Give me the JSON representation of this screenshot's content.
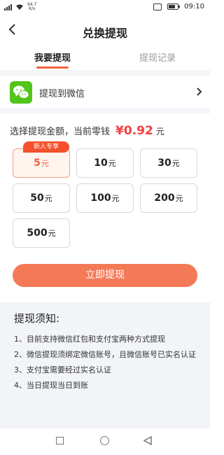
{
  "status_bar": {
    "speed_value": "94.7",
    "speed_unit": "K/s",
    "time": "09:10"
  },
  "header": {
    "title": "兑换提现"
  },
  "tabs": [
    {
      "label": "我要提现"
    },
    {
      "label": "提现记录"
    }
  ],
  "method": {
    "label": "提现到微信",
    "icon": "wechat-icon"
  },
  "amount": {
    "label": "选择提现金额，当前零钱",
    "currency_symbol": "¥",
    "value": "0.92",
    "unit": "元"
  },
  "options": [
    {
      "value": "5",
      "unit": "元",
      "badge": "新人专享",
      "selected": true
    },
    {
      "value": "10",
      "unit": "元"
    },
    {
      "value": "30",
      "unit": "元"
    },
    {
      "value": "50",
      "unit": "元"
    },
    {
      "value": "100",
      "unit": "元"
    },
    {
      "value": "200",
      "unit": "元"
    },
    {
      "value": "500",
      "unit": "元"
    }
  ],
  "withdraw_button": {
    "label": "立即提现"
  },
  "notes": {
    "title": "提现须知:",
    "items": [
      "1、目前支持微信红包和支付宝两种方式提现",
      "2、微信提现须绑定微信账号，且微信账号已实名认证",
      "3、支付宝需要经过实名认证",
      "4、当日提现当日到账"
    ]
  },
  "colors": {
    "accent": "#f0623e",
    "button": "#f47a57",
    "price": "#f04040",
    "wechat": "#52c41a"
  }
}
